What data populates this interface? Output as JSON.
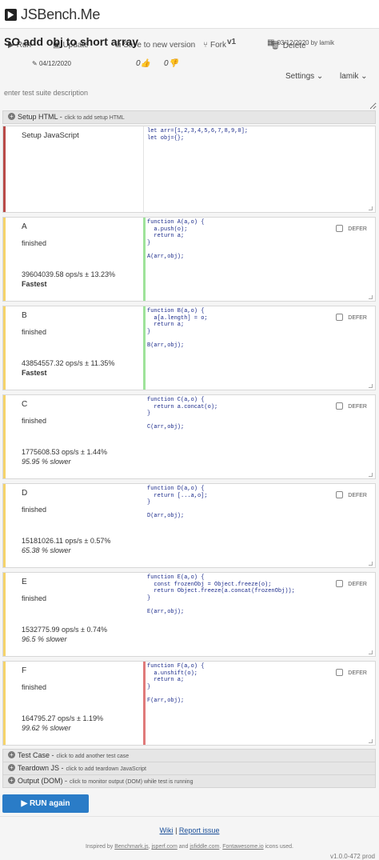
{
  "app": {
    "name": "JSBench.Me"
  },
  "toolbar": {
    "title": "SO add obj to short array",
    "run": "Run",
    "update": "Update",
    "save_new": "Save to new version",
    "fork": "Fork",
    "version": "v1",
    "delete": "Delete",
    "meta_date": "03/12/2020 by lamik",
    "created_date": "04/12/2020",
    "likes": "0",
    "dislikes": "0",
    "settings": "Settings",
    "user": "lamik"
  },
  "description": {
    "placeholder": "enter test suite description"
  },
  "setup_html": {
    "label": "Setup HTML",
    "hint": "click to add setup HTML"
  },
  "setup_js": {
    "label": "Setup JavaScript",
    "code": "let arr=[1,2,3,4,5,6,7,8,9,0];\nlet obj={};"
  },
  "defer_label": "DEFER",
  "cases": [
    {
      "name": "A",
      "status": "finished",
      "ops": "39604039.58 ops/s ± 13.23%",
      "rank": "Fastest",
      "rank_type": "fast",
      "color": "#f5d36a",
      "code_color": "#9ee39a",
      "code": [
        "function A(a,o) {",
        "  a.push(o);",
        "  return a;",
        "}",
        "",
        "A(arr,obj);"
      ]
    },
    {
      "name": "B",
      "status": "finished",
      "ops": "43854557.32 ops/s ± 11.35%",
      "rank": "Fastest",
      "rank_type": "fast",
      "color": "#f5d36a",
      "code_color": "#9ee39a",
      "code": [
        "function B(a,o) {",
        "  a[a.length] = o;",
        "  return a;",
        "}",
        "",
        "B(arr,obj);"
      ]
    },
    {
      "name": "C",
      "status": "finished",
      "ops": "1775608.53 ops/s ± 1.44%",
      "rank": "95.95 % slower",
      "rank_type": "slow",
      "color": "#f5d36a",
      "code_color": "#ffffff",
      "code": [
        "function C(a,o) {",
        "  return a.concat(o);",
        "}",
        "",
        "C(arr,obj);"
      ]
    },
    {
      "name": "D",
      "status": "finished",
      "ops": "15181026.11 ops/s ± 0.57%",
      "rank": "65.38 % slower",
      "rank_type": "slow",
      "color": "#f5d36a",
      "code_color": "#ffffff",
      "code": [
        "function D(a,o) {",
        "  return [...a,o];",
        "}",
        "",
        "D(arr,obj);"
      ]
    },
    {
      "name": "E",
      "status": "finished",
      "ops": "1532775.99 ops/s ± 0.74%",
      "rank": "96.5 % slower",
      "rank_type": "slow",
      "color": "#f5d36a",
      "code_color": "#ffffff",
      "code": [
        "function E(a,o) {",
        "  const frozenObj = Object.freeze(o);",
        "  return Object.freeze(a.concat(frozenObj));",
        "}",
        "",
        "E(arr,obj);"
      ]
    },
    {
      "name": "F",
      "status": "finished",
      "ops": "164795.27 ops/s ± 1.19%",
      "rank": "99.62 % slower",
      "rank_type": "slow",
      "color": "#f5d36a",
      "code_color": "#e07a7a",
      "code": [
        "function F(a,o) {",
        "  a.unshift(o);",
        "  return a;",
        "}",
        "",
        "F(arr,obj);"
      ]
    }
  ],
  "test_case": {
    "label": "Test Case",
    "hint": "click to add another test case"
  },
  "teardown": {
    "label": "Teardown JS",
    "hint": "click to add teardown JavaScript"
  },
  "output": {
    "label": "Output (DOM)",
    "hint": "click to monitor output (DOM) while test is running"
  },
  "run_again": "RUN again",
  "footer": {
    "wiki": "Wiki",
    "sep": "|",
    "report": "Report issue",
    "credit_prefix": "Inspired by",
    "credit_1": "Benchmark.js",
    "credit_2": "jsperf.com",
    "credit_and": "and",
    "credit_3": "jsfiddle.com",
    "credit_4": "Fontawesome.io",
    "credit_suffix": "icons used.",
    "version": "v1.0.0-472 prod"
  },
  "colors": {
    "accent": "#2a7cc7",
    "setup_bar": "#c0504d",
    "case_bar": "#f5d36a"
  }
}
